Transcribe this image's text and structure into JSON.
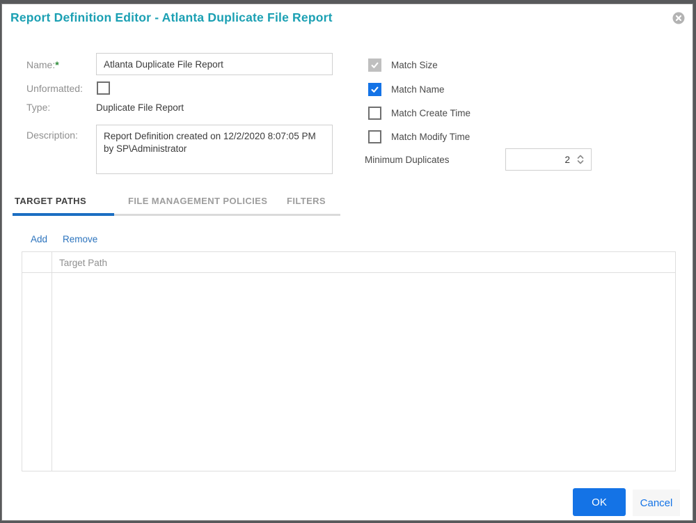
{
  "dialog": {
    "title": "Report Definition Editor - Atlanta Duplicate File Report"
  },
  "form": {
    "name_label": "Name:",
    "required_mark": "*",
    "name_value": "Atlanta Duplicate File Report",
    "unformatted_label": "Unformatted:",
    "unformatted_checked": false,
    "type_label": "Type:",
    "type_value": "Duplicate File Report",
    "description_label": "Description:",
    "description_value": "Report Definition created on 12/2/2020 8:07:05 PM by SP\\Administrator"
  },
  "match_options": [
    {
      "label": "Match Size",
      "checked": true,
      "disabled": true
    },
    {
      "label": "Match Name",
      "checked": true,
      "disabled": false
    },
    {
      "label": "Match Create Time",
      "checked": false,
      "disabled": false
    },
    {
      "label": "Match Modify Time",
      "checked": false,
      "disabled": false
    }
  ],
  "minimum_duplicates": {
    "label": "Minimum Duplicates",
    "value": "2"
  },
  "tabs": [
    {
      "label": "TARGET PATHS",
      "active": true
    },
    {
      "label": "FILE MANAGEMENT POLICIES",
      "active": false
    },
    {
      "label": "FILTERS",
      "active": false
    }
  ],
  "actions": {
    "add": "Add",
    "remove": "Remove"
  },
  "table": {
    "header_target_path": "Target Path",
    "rows": []
  },
  "footer": {
    "ok": "OK",
    "cancel": "Cancel"
  },
  "colors": {
    "accent_blue": "#1473e6",
    "title_teal": "#1ba0b3",
    "link_blue": "#2b73bd",
    "required_green": "#2e8b3a",
    "tab_underline_blue": "#1b6ec2",
    "disabled_checkbox_gray": "#bfbfbf"
  }
}
